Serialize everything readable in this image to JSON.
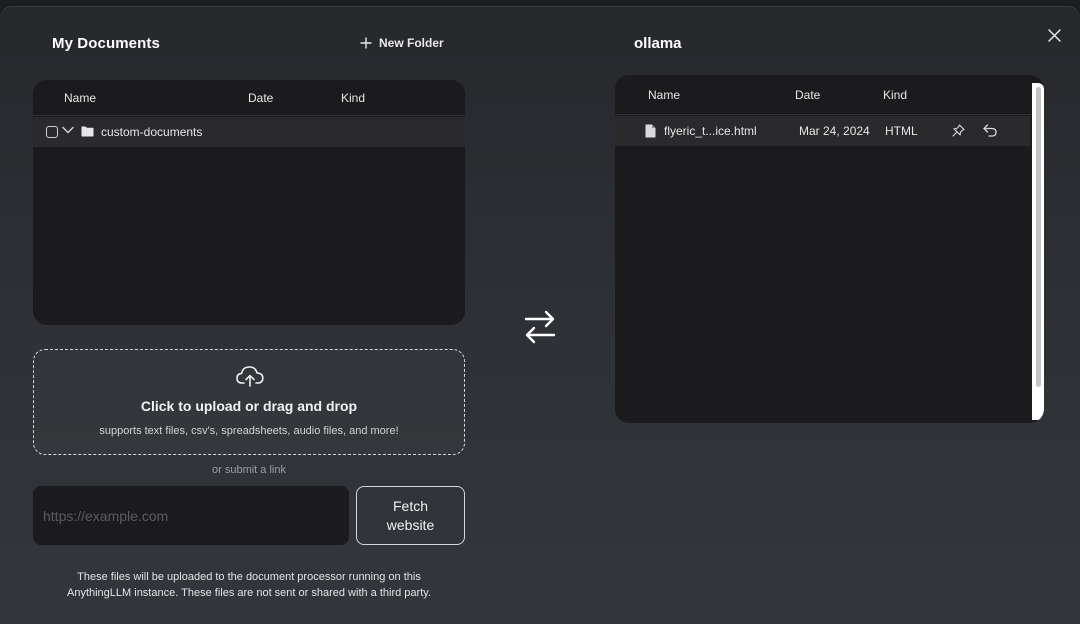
{
  "left": {
    "title": "My Documents",
    "new_folder_label": "New Folder",
    "columns": {
      "name": "Name",
      "date": "Date",
      "kind": "Kind"
    },
    "rows": [
      {
        "name": "custom-documents",
        "type": "folder",
        "icon": "folder-icon"
      }
    ]
  },
  "right": {
    "title": "ollama",
    "columns": {
      "name": "Name",
      "date": "Date",
      "kind": "Kind"
    },
    "rows": [
      {
        "name": "flyeric_t...ice.html",
        "date": "Mar 24, 2024",
        "kind": "HTML",
        "icon": "file-icon"
      }
    ]
  },
  "upload": {
    "title": "Click to upload or drag and drop",
    "subtitle": "supports text files, csv's, spreadsheets, audio files, and more!",
    "icon": "cloud-upload-icon",
    "or_link": "or submit a link",
    "url_placeholder": "https://example.com",
    "url_value": "",
    "fetch_label": "Fetch\nwebsite"
  },
  "disclaimer_line1": "These files will be uploaded to the document processor running on this",
  "disclaimer_line2": "AnythingLLM instance. These files are not sent or shared with a third party.",
  "icons": {
    "close": "close-icon",
    "swap": "swap-arrows-icon",
    "pin": "pin-icon",
    "undo": "undo-icon",
    "plus": "plus-icon",
    "chevron": "chevron-down-icon"
  },
  "colors": {
    "background": "#2e3136",
    "panel": "#1b1b1d",
    "row_highlight": "#2a2a2d",
    "text": "#ffffff"
  }
}
